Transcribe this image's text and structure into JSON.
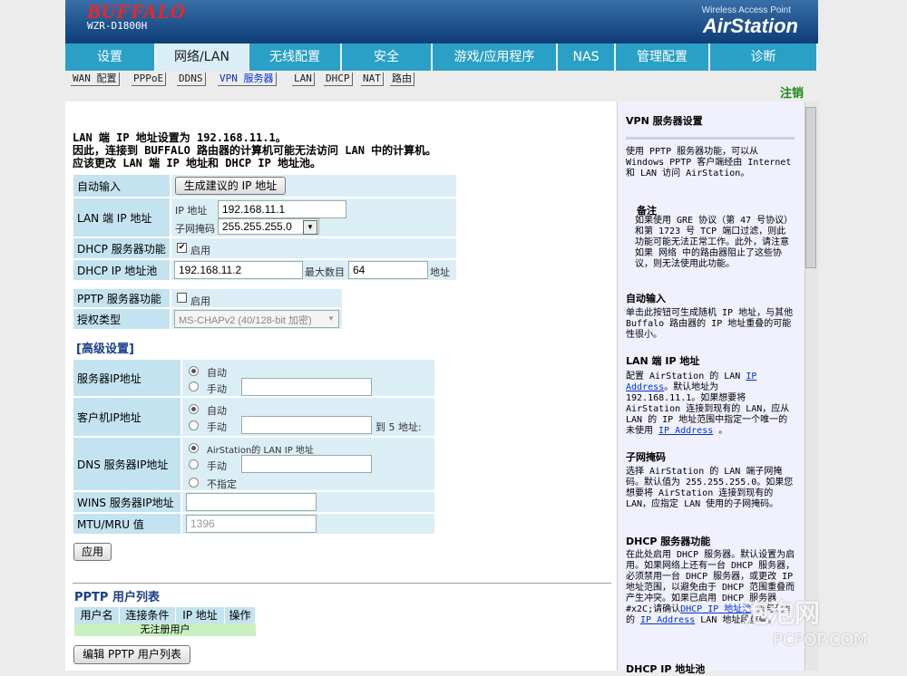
{
  "header": {
    "logo": "BUFFALO",
    "model": "WZR-D1800H",
    "brand_sub": "Wireless Access Point",
    "brand": "AirStation"
  },
  "nav": {
    "tabs": [
      {
        "label": "设置",
        "w": 100
      },
      {
        "label": "网络/LAN",
        "w": 103,
        "active": true
      },
      {
        "label": "无线配置",
        "w": 102
      },
      {
        "label": "安全",
        "w": 100
      },
      {
        "label": "游戏/应用程序",
        "w": 138
      },
      {
        "label": "NAS",
        "w": 64
      },
      {
        "label": "管理配置",
        "w": 104
      },
      {
        "label": "诊断",
        "w": 119
      }
    ]
  },
  "subnav": {
    "items": [
      "WAN 配置",
      "PPPoE",
      "DDNS",
      "VPN 服务器",
      "LAN",
      "DHCP",
      "NAT",
      "路由"
    ],
    "logout": "注销"
  },
  "notice": [
    "LAN 端 IP 地址设置为 192.168.11.1。",
    "因此，连接到 BUFFALO 路由器的计算机可能无法访问 LAN 中的计算机。",
    "应该更改 LAN 端 IP 地址和 DHCP IP 地址池。"
  ],
  "form": {
    "auto_label": "自动输入",
    "auto_button": "生成建议的 IP 地址",
    "lan_ip_label": "LAN 端 IP 地址",
    "ip_label": "IP 地址",
    "ip_value": "192.168.11.1",
    "mask_label": "子网掩码",
    "mask_value": "255.255.255.0",
    "dhcp_label": "DHCP 服务器功能",
    "dhcp_enable": "启用",
    "pool_label": "DHCP IP 地址池",
    "pool_start": "192.168.11.2",
    "pool_max_label": "最大数目",
    "pool_max": "64",
    "pool_unit": "地址",
    "pptp_label": "PPTP 服务器功能",
    "pptp_enable": "启用",
    "auth_label": "授权类型",
    "auth_value": "MS-CHAPv2 (40/128-bit 加密)"
  },
  "advanced": {
    "title": "[高级设置]",
    "server_ip_label": "服务器IP地址",
    "auto": "自动",
    "manual": "手动",
    "client_ip_label": "客户机IP地址",
    "client_range_suffix": "到 5 地址:",
    "dns_label": "DNS 服务器IP地址",
    "dns_opt1": "AirStation的 LAN IP 地址",
    "dns_opt3": "不指定",
    "wins_label": "WINS 服务器IP地址",
    "mtu_label": "MTU/MRU 值",
    "mtu_value": "1396",
    "apply": "应用"
  },
  "users": {
    "title": "PPTP 用户列表",
    "columns": [
      "用户名",
      "连接条件",
      "IP 地址",
      "操作"
    ],
    "empty": "无注册用户",
    "edit_button": "编辑 PPTP 用户列表"
  },
  "sidebar": {
    "title": "VPN 服务器设置",
    "intro": "使用 PPTP 服务器功能，可以从 Windows PPTP 客户端经由 Internet 和 LAN 访问 AirStation。",
    "note_title": "备注",
    "note_text": "如果使用 GRE 协议（第 47 号协议）和第 1723 号 TCP 端口过滤，则此功能可能无法正常工作。此外，请注意如果 网络 中的路由器阻止了这些协议，则无法使用此功能。",
    "auto_title": "自动输入",
    "auto_text": "单击此按钮可生成随机 IP 地址，与其他 Buffalo 路由器的 IP 地址重叠的可能性很小。",
    "lanip_title": "LAN 端 IP 地址",
    "lanip_text1": "配置 AirStation 的 LAN",
    "lanip_link1": "IP Address",
    "lanip_text2": "。默认地址为 192.168.11.1。如果想要将 AirStation 连接到现有的 LAN，应从 LAN 的 IP 地址范围中指定一个唯一的未使用",
    "lanip_link2": "IP Address",
    "lanip_text3": "。",
    "mask_title": "子网掩码",
    "mask_text": "选择 AirStation 的 LAN 端子网掩码。默认值为 255.255.255.0。如果您想要将 AirStation 连接到现有的 LAN，应指定 LAN 使用的子网掩码。",
    "dhcp_title": "DHCP 服务器功能",
    "dhcp_text": "在此处启用 DHCP 服务器。默认设置为启用。如果网络上还有一台 DHCP 服务器，必须禁用一台 DHCP 服务器，或更改 IP 地址范围，以避免由于 DHCP 范围重叠而产生冲突。如果已启用 DHCP 服务器#x2C;请确认",
    "dhcp_link": "DHCP IP 地址池",
    "dhcp_text2": "未与现有的",
    "dhcp_link2": "IP Address",
    "dhcp_text3": "LAN 地址段重叠。",
    "pool_title": "DHCP IP 地址池"
  },
  "watermark": {
    "big": "泡泡网",
    "small": "PCPOP.COM"
  }
}
